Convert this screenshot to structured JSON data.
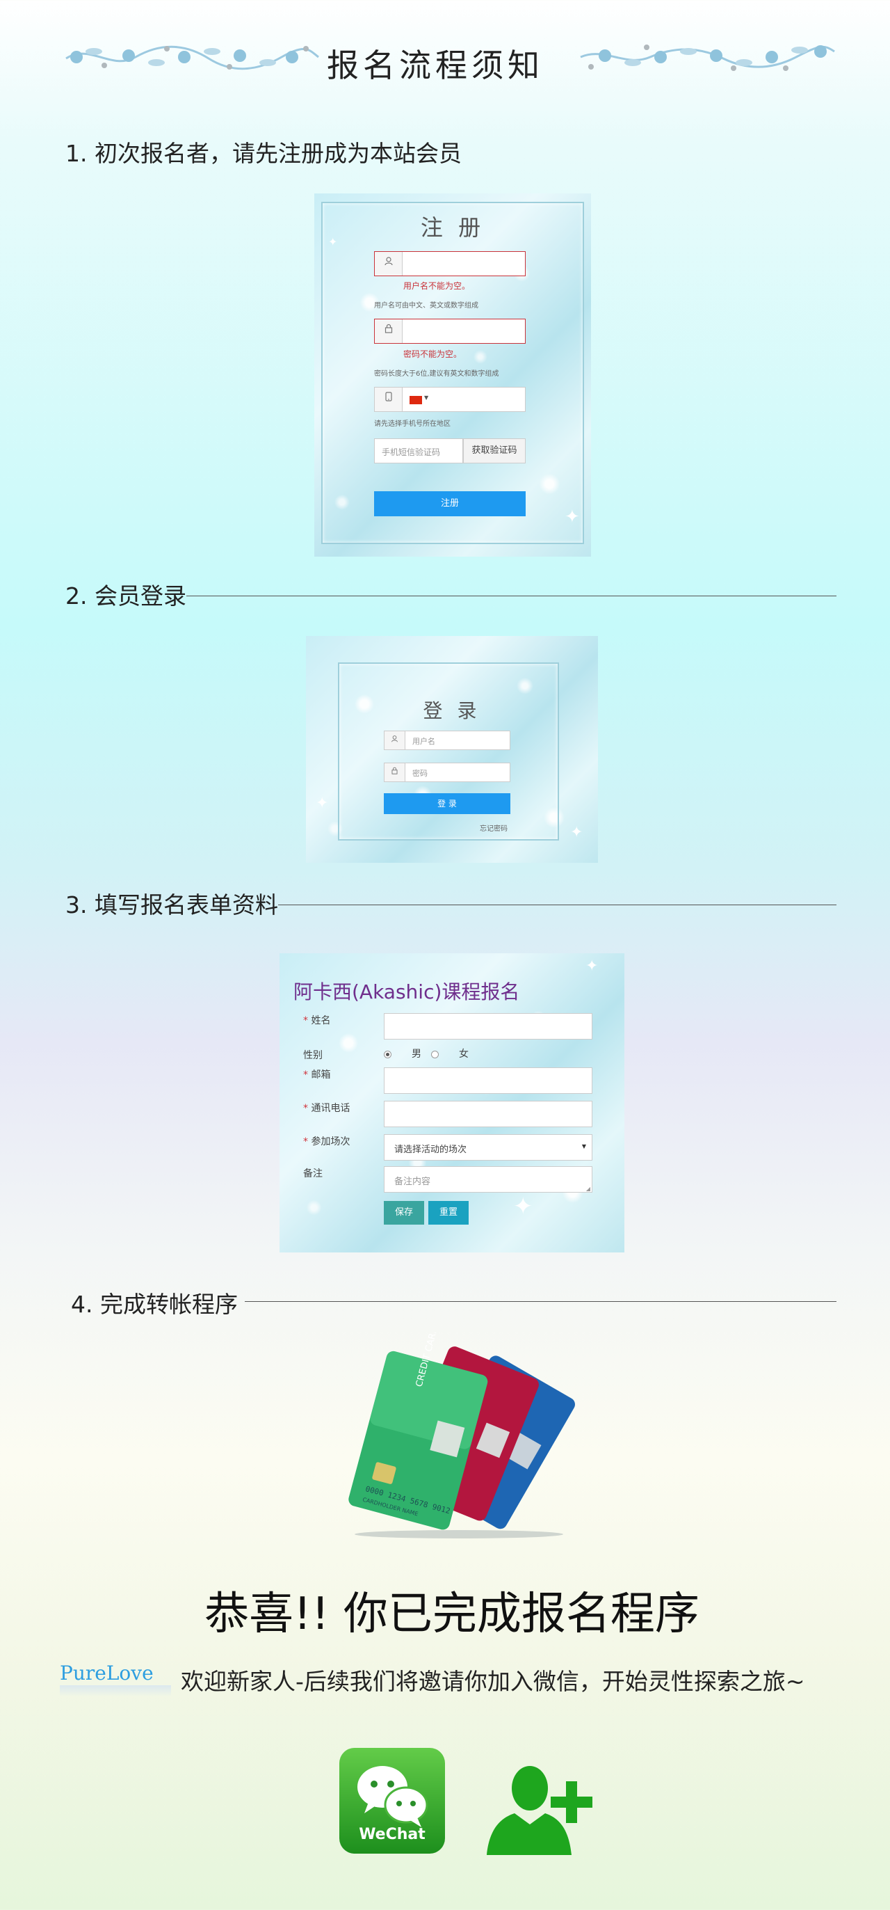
{
  "header": {
    "title": "报名流程须知"
  },
  "steps": {
    "step1": "1. 初次报名者，请先注册成为本站会员",
    "step2": "2. 会员登录",
    "step3": "3. 填写报名表单资料",
    "step4": "4. 完成转帐程序"
  },
  "register": {
    "title": "注 册",
    "username_error": "用户名不能为空。",
    "username_hint": "用户名可由中文、英文或数字组成",
    "password_error": "密码不能为空。",
    "password_hint": "密码长度大于6位,建议有英文和数字组成",
    "phone_hint": "请先选择手机号所在地区",
    "sms_placeholder": "手机短信验证码",
    "get_code": "获取验证码",
    "submit": "注册"
  },
  "login": {
    "title": "登 录",
    "username_placeholder": "用户名",
    "password_placeholder": "密码",
    "submit": "登 录",
    "forgot": "忘记密码"
  },
  "form": {
    "title": "阿卡西(Akashic)课程报名",
    "name_label": "姓名",
    "gender_label": "性别",
    "male": "男",
    "female": "女",
    "email_label": "邮箱",
    "phone_label": "通讯电话",
    "session_label": "参加场次",
    "session_value": "请选择活动的场次",
    "notes_label": "备注",
    "notes_placeholder": "备注内容",
    "save": "保存",
    "reset": "重置"
  },
  "cards": {
    "card_text": "CREDIT CARD",
    "card_number": "0000 1234 5678 9012",
    "holder": "CARDHOLDER NAME"
  },
  "congrats": {
    "headline": "恭喜!! 你已完成报名程序",
    "brand": "PureLove",
    "welcome": "欢迎新家人-后续我们将邀请你加入微信，开始灵性探索之旅~",
    "wechat": "WeChat"
  }
}
